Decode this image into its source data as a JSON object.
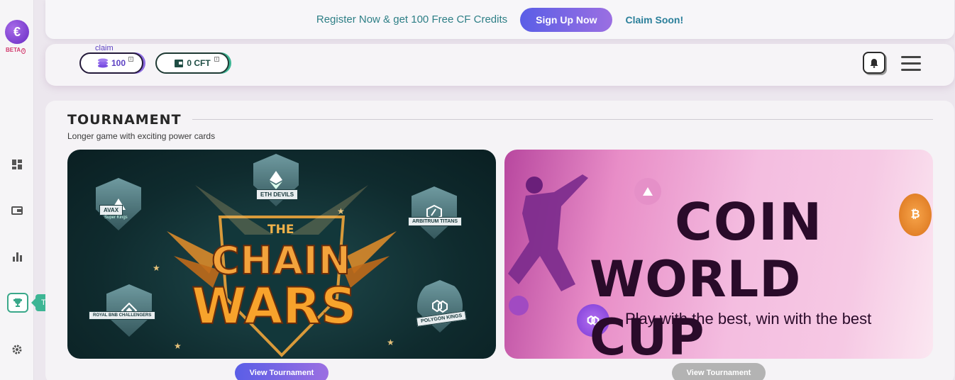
{
  "sidebar": {
    "logo_letter": "€",
    "beta_label": "BETA",
    "items": [
      {
        "name": "dashboard",
        "icon": "grid-icon"
      },
      {
        "name": "wallet",
        "icon": "wallet-icon"
      },
      {
        "name": "stats",
        "icon": "bar-chart-icon"
      },
      {
        "name": "tournaments",
        "icon": "trophy-icon",
        "active": true
      },
      {
        "name": "settings",
        "icon": "gear-icon"
      }
    ],
    "tooltip": "Tournaments"
  },
  "banner": {
    "text": "Register Now & get 100 Free CF Credits",
    "signup_label": "Sign Up Now",
    "claim_soon": "Claim Soon!"
  },
  "topbar": {
    "claim_label": "claim",
    "coins_value": "100",
    "cft_value": "0 CFT"
  },
  "section": {
    "title": "TOURNAMENT",
    "subtitle": "Longer game with exciting power cards"
  },
  "cards": [
    {
      "the": "THE",
      "line1": "CHAIN",
      "line2": "WARS",
      "badges": {
        "avax": "AVAX",
        "avax_sub": "Super Kings",
        "eth": "ETH DEVILS",
        "arb": "ARBITRUM TITANS",
        "bnb": "ROYAL BNB CHALLENGERS",
        "poly": "POLYGON KINGS"
      },
      "button": "View Tournament"
    },
    {
      "line1": "COIN",
      "line2": "WORLD CUP",
      "tagline": "Play with the best, win with the best",
      "button": "View Tournament"
    }
  ],
  "colors": {
    "accent_purple": "#6f5fe4",
    "accent_teal": "#3db594",
    "banner_text": "#2e7f86"
  }
}
